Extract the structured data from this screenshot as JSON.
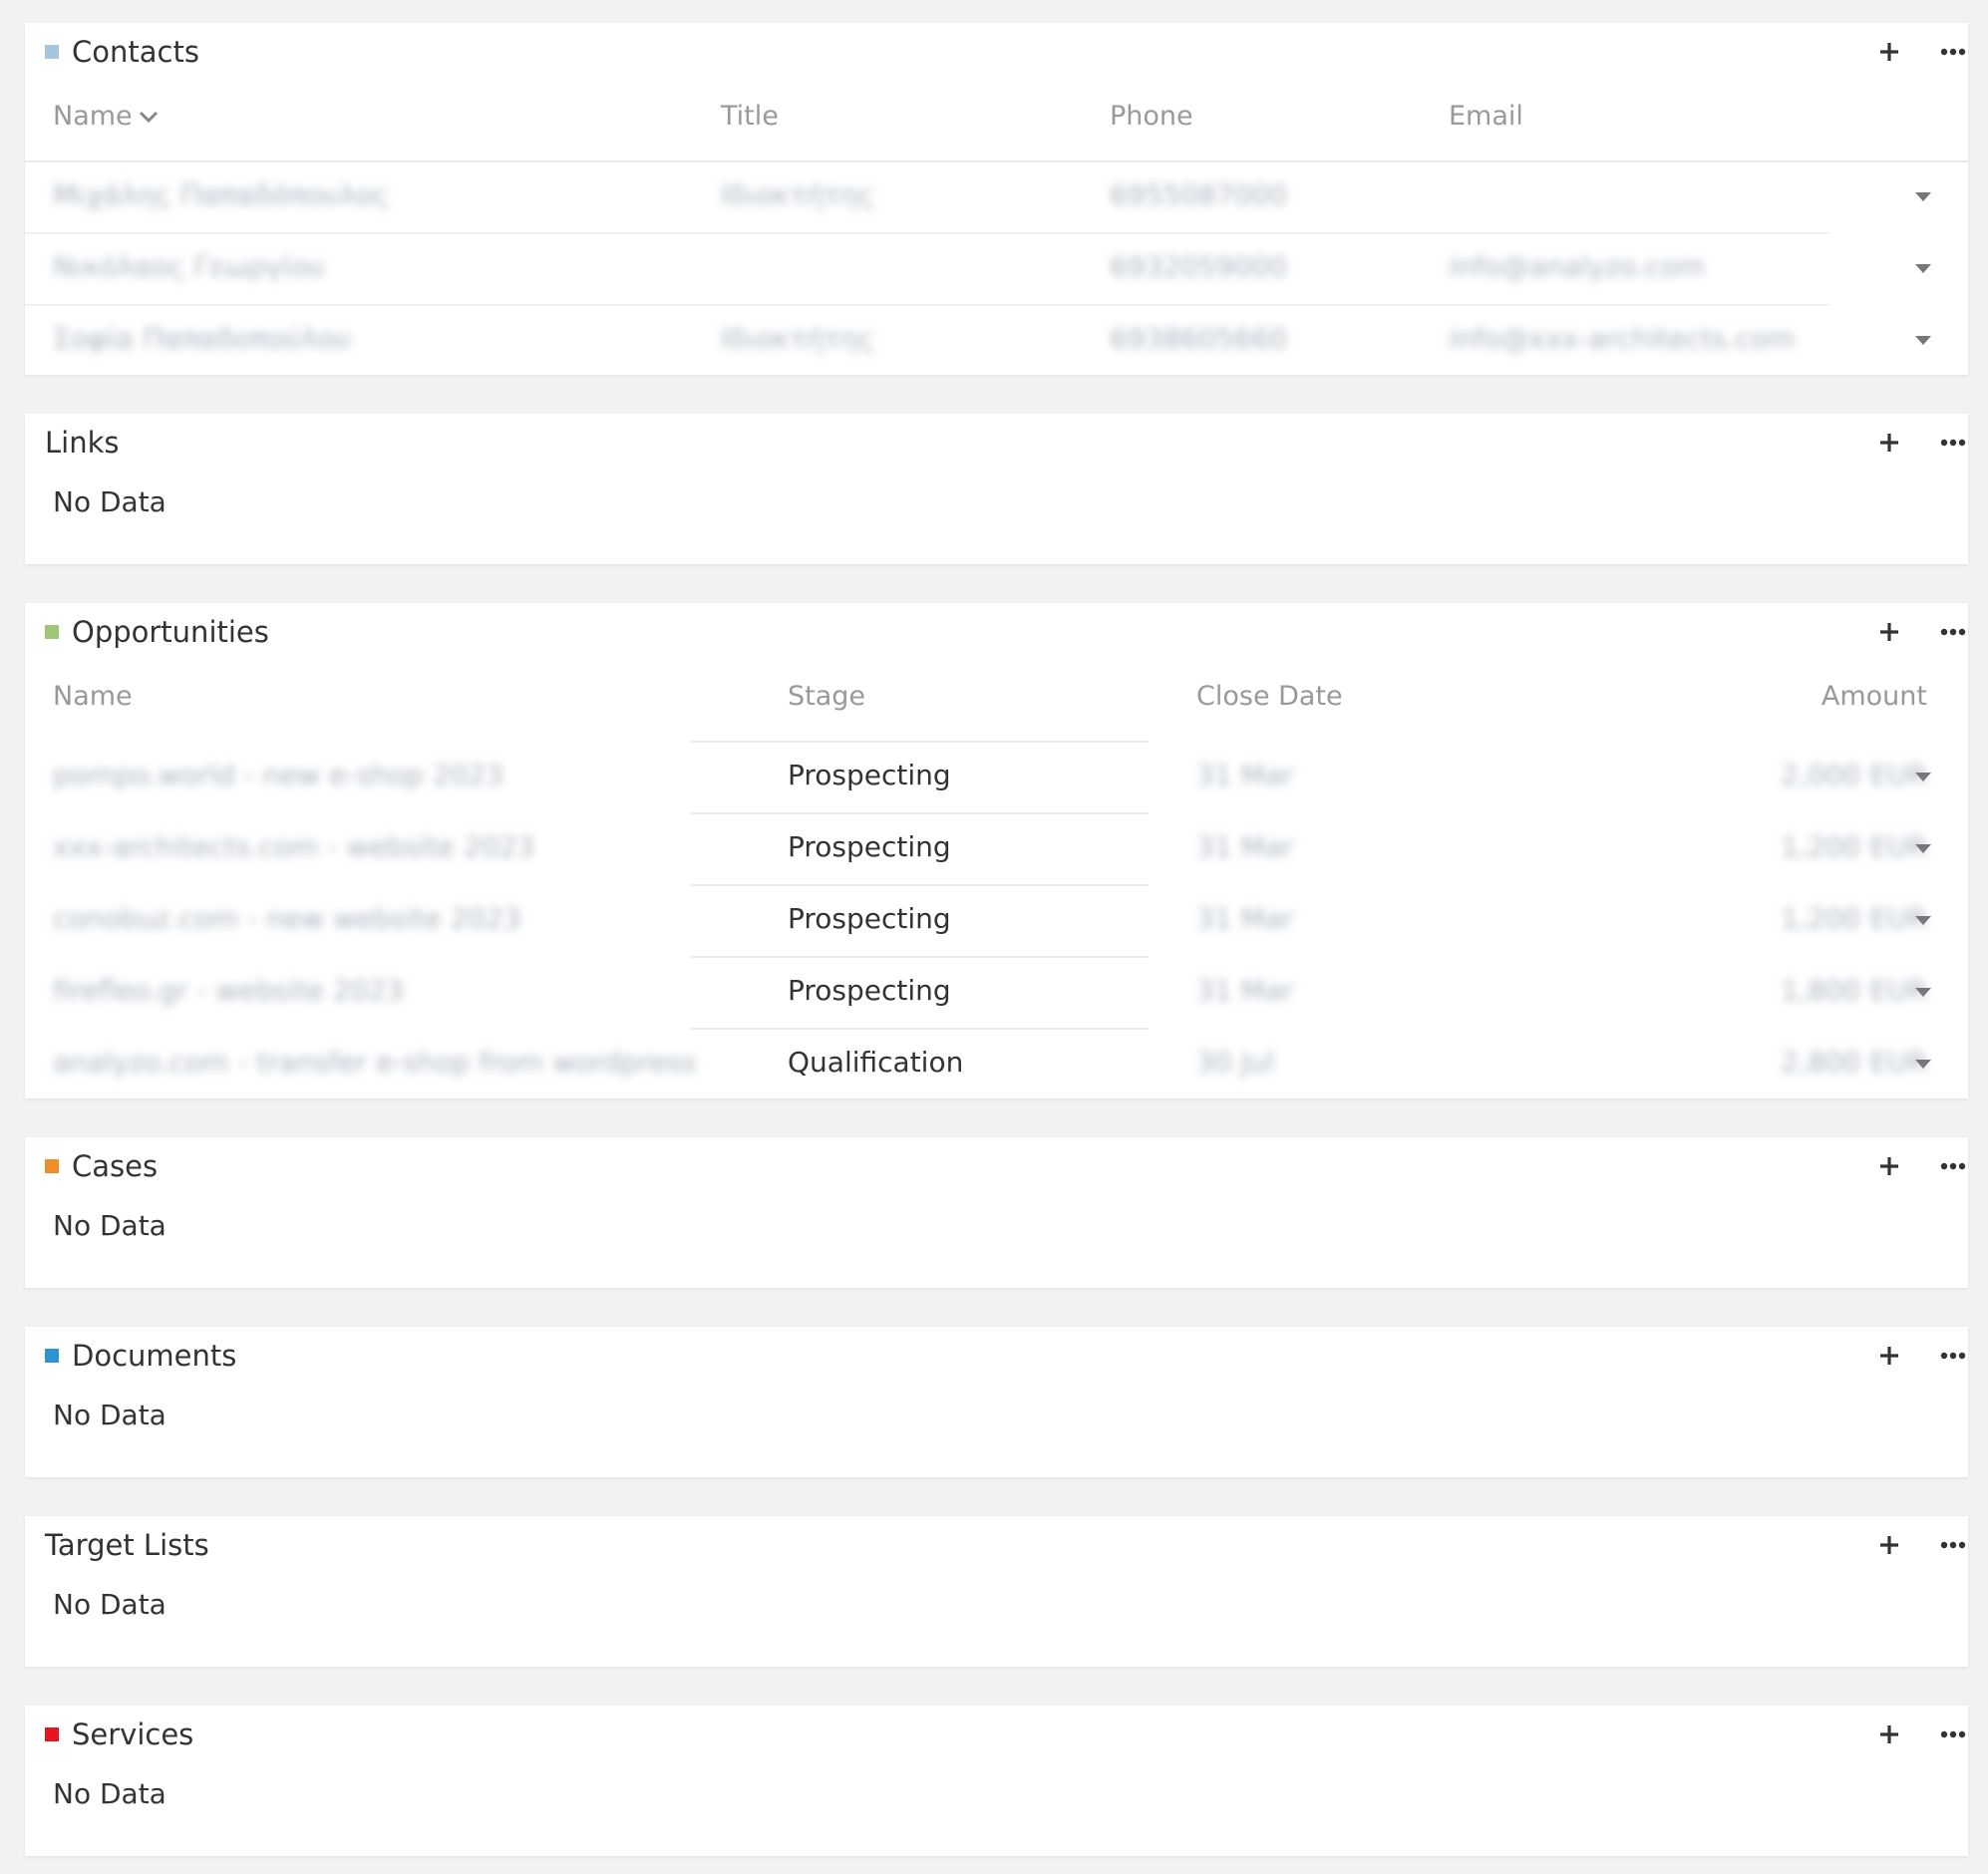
{
  "contacts": {
    "title": "Contacts",
    "color": "#a6c3e0",
    "columns": {
      "name": "Name",
      "title": "Title",
      "phone": "Phone",
      "email": "Email"
    },
    "rows": [
      {
        "name": "Μιχάλης Παπαδόπουλος",
        "title": "Ιδιοκτήτης",
        "phone": "6955087000",
        "email": ""
      },
      {
        "name": "Νικόλαος Γεωργίου",
        "title": "",
        "phone": "6932059000",
        "email": "info@analyzo.com"
      },
      {
        "name": "Σοφία Παπαδοπούλου",
        "title": "Ιδιοκτήτης",
        "phone": "6938605660",
        "email": "info@xxx-architects.com"
      }
    ]
  },
  "links": {
    "title": "Links",
    "no_data": "No Data"
  },
  "opportunities": {
    "title": "Opportunities",
    "color": "#9ec878",
    "columns": {
      "name": "Name",
      "stage": "Stage",
      "close_date": "Close Date",
      "amount": "Amount"
    },
    "rows": [
      {
        "name": "pompo.world - new e-shop 2023",
        "stage": "Prospecting",
        "close_date": "31 Mar",
        "amount": "2,000 EUR"
      },
      {
        "name": "xxx-architects.com - website 2023",
        "stage": "Prospecting",
        "close_date": "31 Mar",
        "amount": "1,200 EUR"
      },
      {
        "name": "conobuz.com - new website 2023",
        "stage": "Prospecting",
        "close_date": "31 Mar",
        "amount": "1,200 EUR"
      },
      {
        "name": "firefleo.gr - website 2023",
        "stage": "Prospecting",
        "close_date": "31 Mar",
        "amount": "1,800 EUR"
      },
      {
        "name": "analyzo.com - transfer e-shop from wordpress",
        "stage": "Qualification",
        "close_date": "30 Jul",
        "amount": "2,800 EUR"
      }
    ]
  },
  "cases": {
    "title": "Cases",
    "color": "#f08e29",
    "no_data": "No Data"
  },
  "documents": {
    "title": "Documents",
    "color": "#2e93d4",
    "no_data": "No Data"
  },
  "target_lists": {
    "title": "Target Lists",
    "no_data": "No Data"
  },
  "services": {
    "title": "Services",
    "color": "#e8141b",
    "no_data": "No Data"
  }
}
